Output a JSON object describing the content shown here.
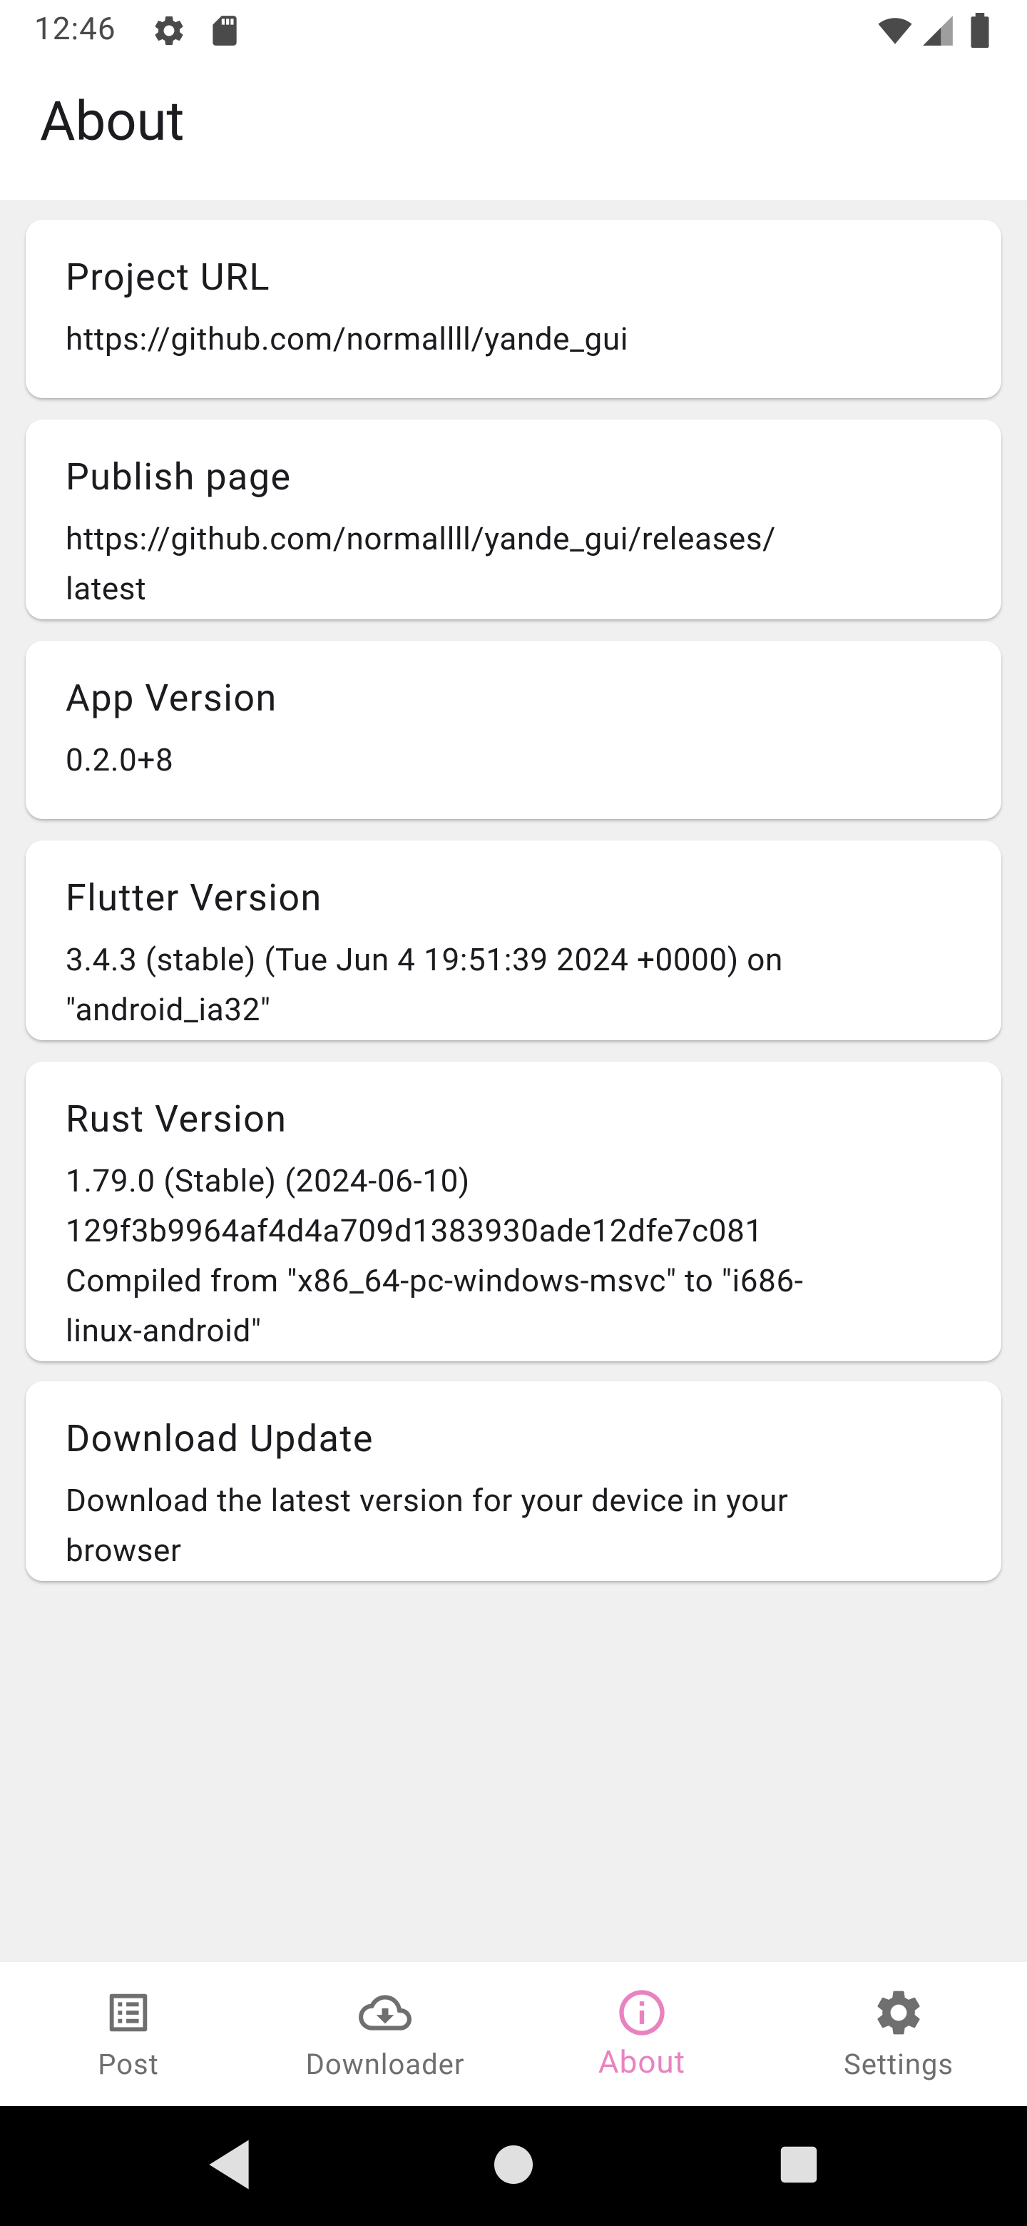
{
  "status_bar": {
    "time": "12:46",
    "icons": [
      "settings-icon",
      "sd-card-icon",
      "wifi-icon",
      "cell-signal-icon",
      "battery-icon"
    ]
  },
  "app_bar": {
    "title": "About"
  },
  "cards": [
    {
      "title": "Project URL",
      "subtitle": "https://github.com/normallll/yande_gui"
    },
    {
      "title": "Publish page",
      "subtitle": "https://github.com/normallll/yande_gui/releases/\nlatest"
    },
    {
      "title": "App Version",
      "subtitle": "0.2.0+8"
    },
    {
      "title": "Flutter Version",
      "subtitle": "3.4.3 (stable) (Tue Jun 4 19:51:39 2024 +0000) on\n\"android_ia32\""
    },
    {
      "title": "Rust Version",
      "subtitle": "1.79.0 (Stable) (2024-06-10)\n129f3b9964af4d4a709d1383930ade12dfe7c081\nCompiled from \"x86_64-pc-windows-msvc\" to \"i686-\nlinux-android\""
    },
    {
      "title": "Download Update",
      "subtitle": "Download the latest version for your device in your\nbrowser"
    }
  ],
  "bottom_nav": {
    "items": [
      {
        "label": "Post",
        "icon": "list-icon",
        "active": false
      },
      {
        "label": "Downloader",
        "icon": "cloud-download-icon",
        "active": false
      },
      {
        "label": "About",
        "icon": "info-icon",
        "active": true
      },
      {
        "label": "Settings",
        "icon": "settings-icon",
        "active": false
      }
    ]
  },
  "system_nav": {
    "buttons": [
      "back-icon",
      "home-icon",
      "recents-icon"
    ]
  },
  "colors": {
    "accent": "#e883bf",
    "background": "#f0f0f0",
    "card": "#ffffff",
    "nav_inactive": "#6f6f6f"
  }
}
